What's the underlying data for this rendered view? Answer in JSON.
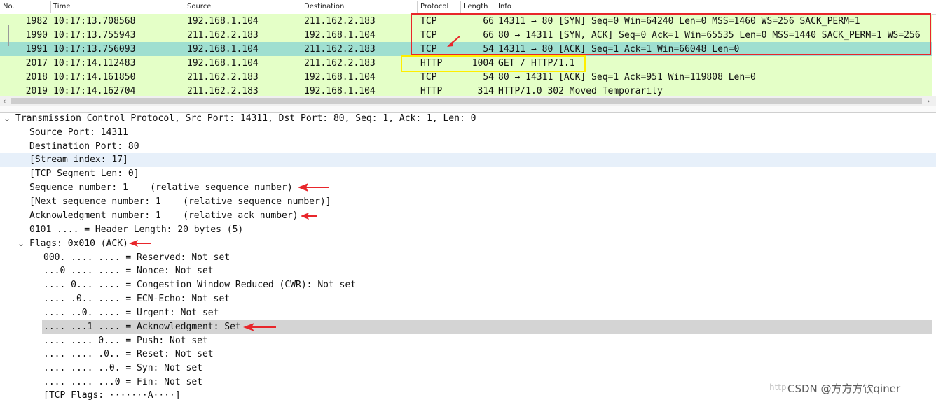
{
  "packet_list": {
    "columns": [
      "No.",
      "Time",
      "Source",
      "Destination",
      "Protocol",
      "Length",
      "Info"
    ],
    "rows": [
      {
        "no": "1982",
        "time": "10:17:13.708568",
        "source": "192.168.1.104",
        "destination": "211.162.2.183",
        "protocol": "TCP",
        "length": "66",
        "info": "14311 → 80 [SYN] Seq=0 Win=64240 Len=0 MSS=1460 WS=256 SACK_PERM=1"
      },
      {
        "no": "1990",
        "time": "10:17:13.755943",
        "source": "211.162.2.183",
        "destination": "192.168.1.104",
        "protocol": "TCP",
        "length": "66",
        "info": "80 → 14311 [SYN, ACK] Seq=0 Ack=1 Win=65535 Len=0 MSS=1440 SACK_PERM=1 WS=256"
      },
      {
        "no": "1991",
        "time": "10:17:13.756093",
        "source": "192.168.1.104",
        "destination": "211.162.2.183",
        "protocol": "TCP",
        "length": "54",
        "info": "14311 → 80 [ACK] Seq=1 Ack=1 Win=66048 Len=0"
      },
      {
        "no": "2017",
        "time": "10:17:14.112483",
        "source": "192.168.1.104",
        "destination": "211.162.2.183",
        "protocol": "HTTP",
        "length": "1004",
        "info": "GET / HTTP/1.1"
      },
      {
        "no": "2018",
        "time": "10:17:14.161850",
        "source": "211.162.2.183",
        "destination": "192.168.1.104",
        "protocol": "TCP",
        "length": "54",
        "info": "80 → 14311 [ACK] Seq=1 Ack=951 Win=119808 Len=0"
      },
      {
        "no": "2019",
        "time": "10:17:14.162704",
        "source": "211.162.2.183",
        "destination": "192.168.1.104",
        "protocol": "HTTP",
        "length": "314",
        "info": "HTTP/1.0 302 Moved Temporarily"
      }
    ],
    "row_color": "#e4ffc7",
    "selected_color": "#9fdfd0"
  },
  "details": {
    "tcp_header": "Transmission Control Protocol, Src Port: 14311, Dst Port: 80, Seq: 1, Ack: 1, Len: 0",
    "fields": [
      "Source Port: 14311",
      "Destination Port: 80",
      "[Stream index: 17]",
      "[TCP Segment Len: 0]",
      "Sequence number: 1    (relative sequence number)",
      "[Next sequence number: 1    (relative sequence number)]",
      "Acknowledgment number: 1    (relative ack number)",
      "0101 .... = Header Length: 20 bytes (5)"
    ],
    "flags_header": "Flags: 0x010 (ACK)",
    "flags": [
      "000. .... .... = Reserved: Not set",
      "...0 .... .... = Nonce: Not set",
      ".... 0... .... = Congestion Window Reduced (CWR): Not set",
      ".... .0.. .... = ECN-Echo: Not set",
      ".... ..0. .... = Urgent: Not set",
      ".... ...1 .... = Acknowledgment: Set",
      ".... .... 0... = Push: Not set",
      ".... .... .0.. = Reset: Not set",
      ".... .... ..0. = Syn: Not set",
      ".... .... ...0 = Fin: Not set",
      "[TCP Flags: ·······A····]"
    ]
  },
  "watermark": {
    "prefix": "http",
    "text": "CSDN @方方方钦qiner"
  },
  "colors": {
    "annotation_red": "#e8262b",
    "annotation_yellow": "#ffee00",
    "hl_blue": "#e7f0fa",
    "hl_gray": "#d4d4d4"
  }
}
